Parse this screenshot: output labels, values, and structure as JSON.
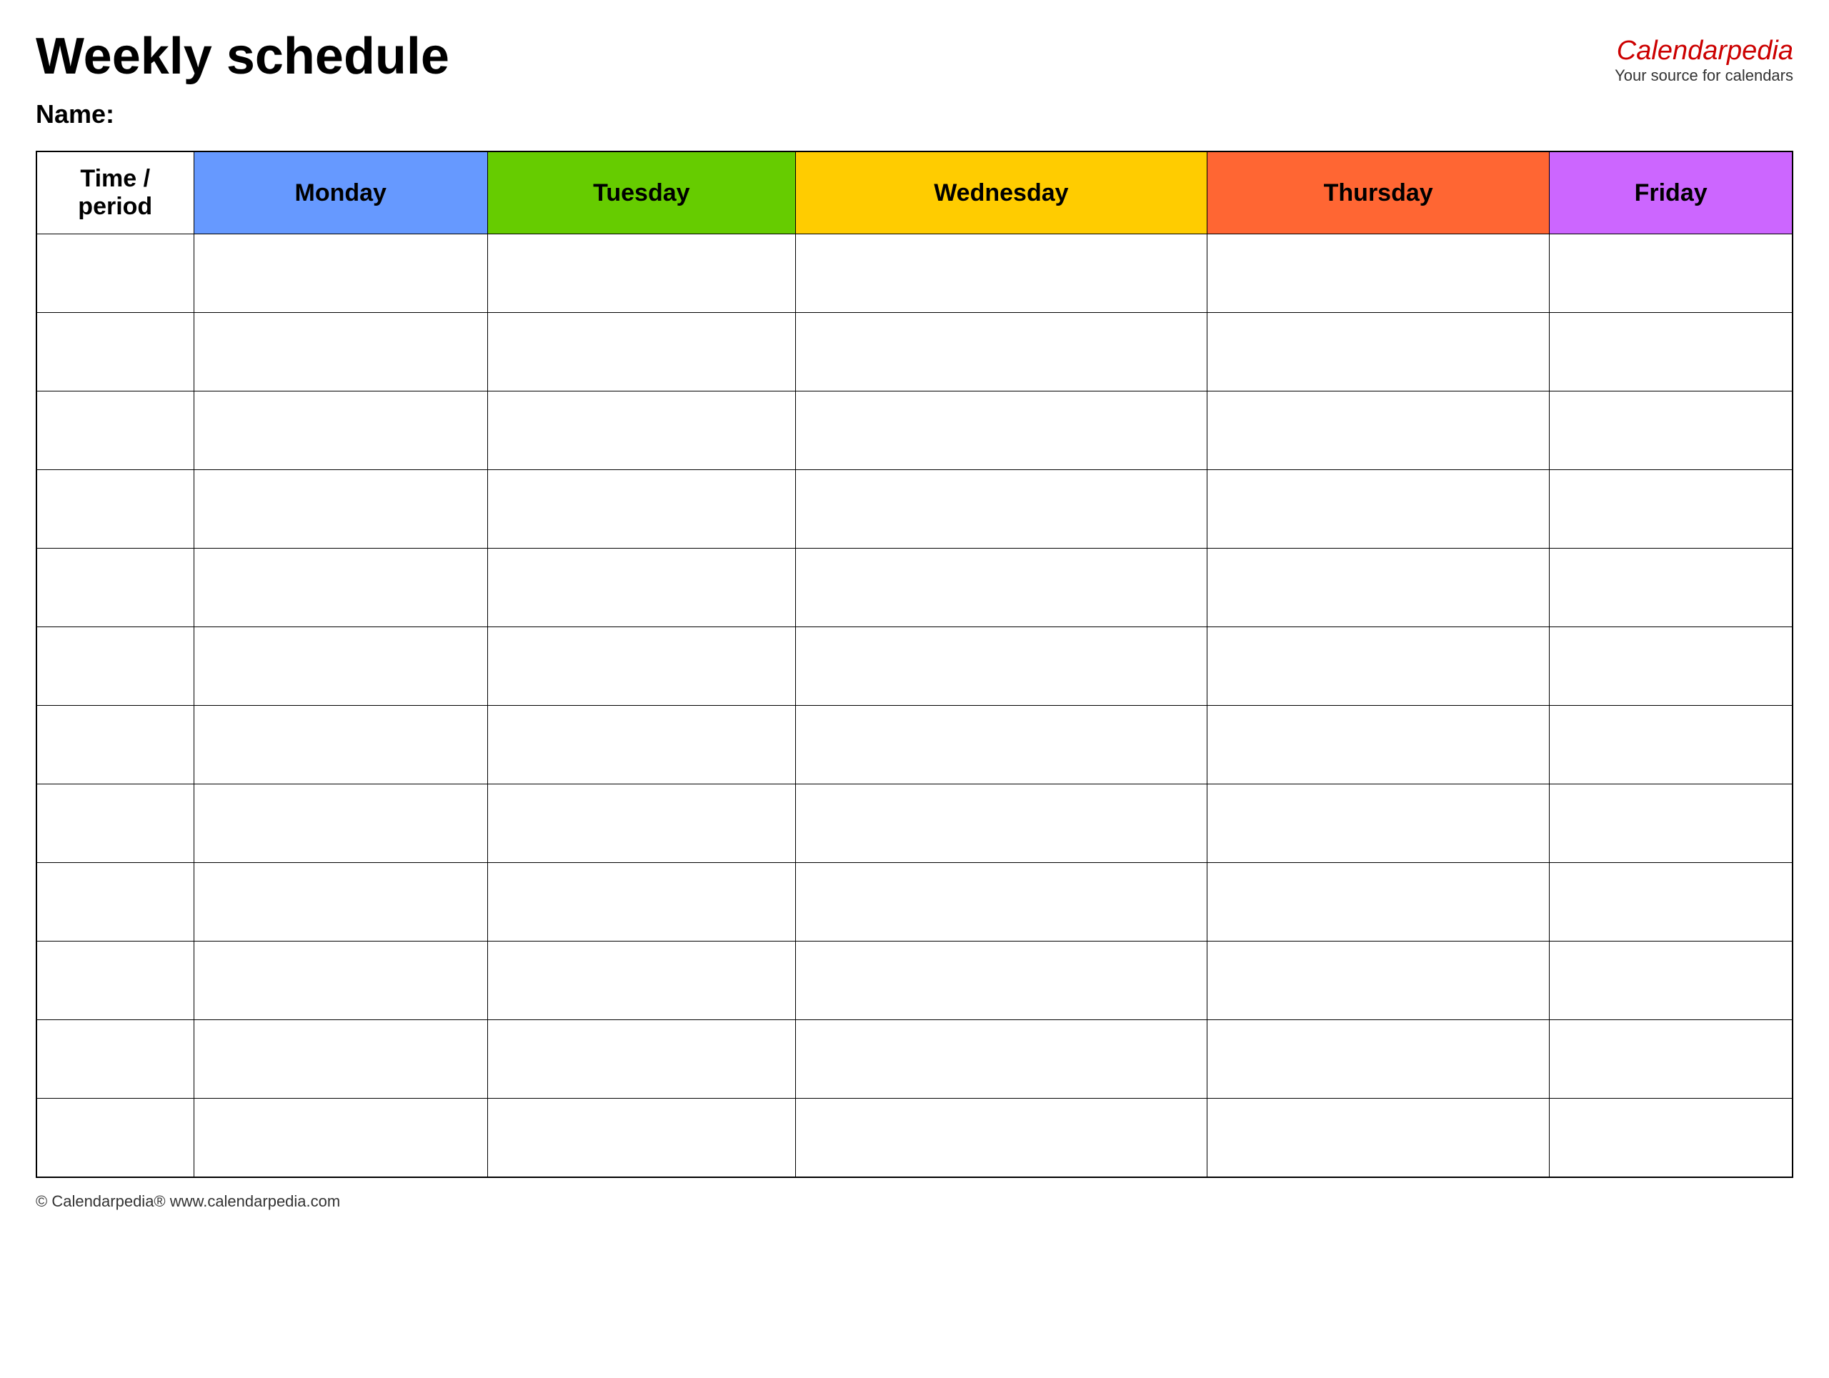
{
  "header": {
    "title": "Weekly schedule",
    "brand": {
      "name_plain": "Calendar",
      "name_italic": "pedia",
      "tagline": "Your source for calendars"
    }
  },
  "name_label": "Name:",
  "table": {
    "columns": [
      {
        "id": "time",
        "label": "Time / period",
        "class": "col-time"
      },
      {
        "id": "monday",
        "label": "Monday",
        "class": "col-monday"
      },
      {
        "id": "tuesday",
        "label": "Tuesday",
        "class": "col-tuesday"
      },
      {
        "id": "wednesday",
        "label": "Wednesday",
        "class": "col-wednesday"
      },
      {
        "id": "thursday",
        "label": "Thursday",
        "class": "col-thursday"
      },
      {
        "id": "friday",
        "label": "Friday",
        "class": "col-friday"
      }
    ],
    "row_count": 12
  },
  "footer": {
    "text": "© Calendarpedia®  www.calendarpedia.com"
  }
}
